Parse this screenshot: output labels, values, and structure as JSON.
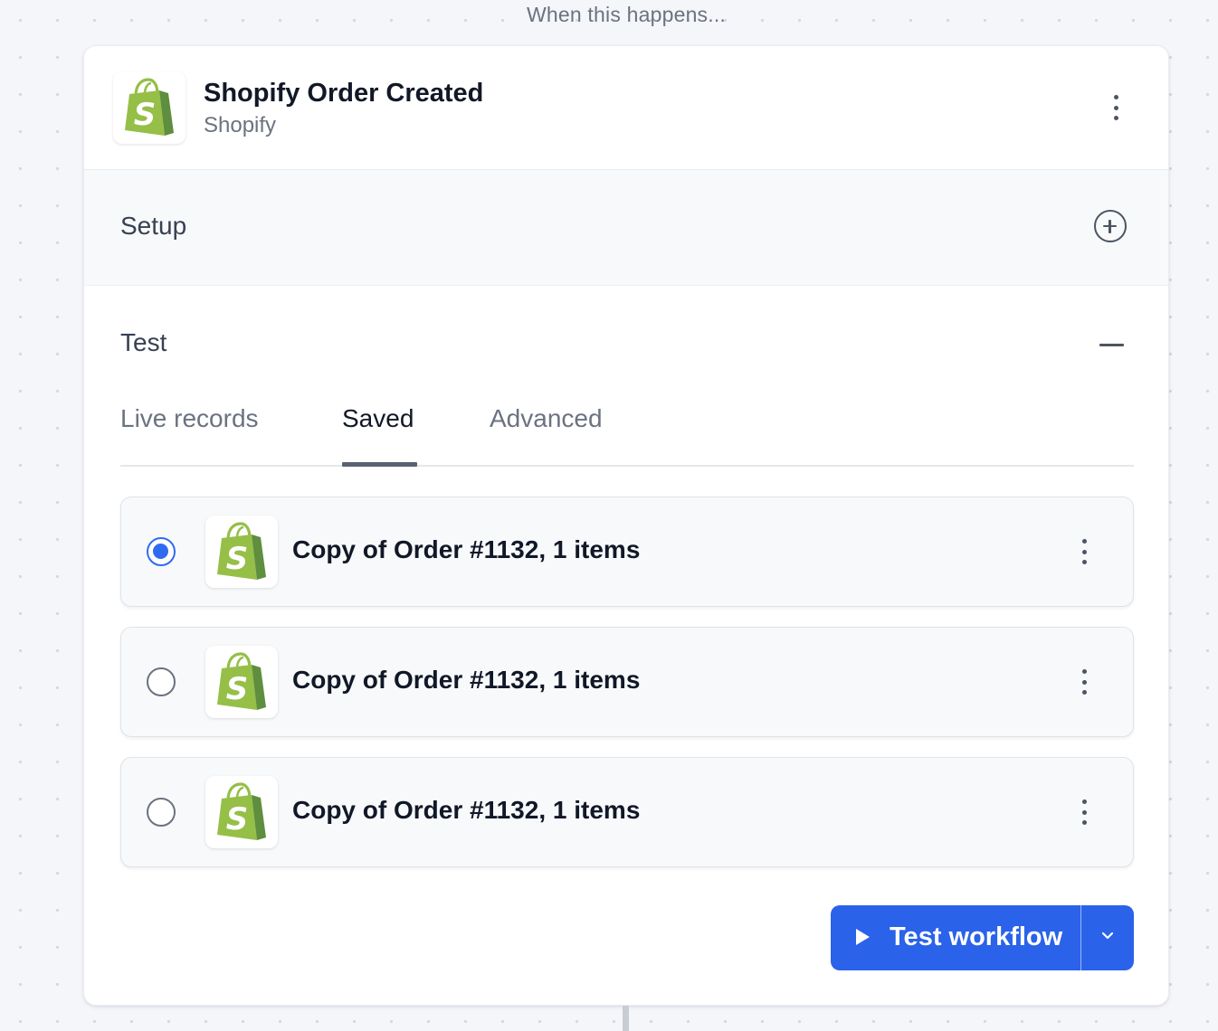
{
  "canvas": {
    "caption": "When this happens..."
  },
  "trigger": {
    "title": "Shopify Order Created",
    "app": "Shopify",
    "icon": "shopify-bag-icon"
  },
  "setup": {
    "title": "Setup",
    "expand_icon": "plus-circle-icon"
  },
  "test": {
    "title": "Test",
    "collapse_icon": "minus-icon",
    "tabs": [
      {
        "label": "Live records",
        "active": false
      },
      {
        "label": "Saved",
        "active": true
      },
      {
        "label": "Advanced",
        "active": false
      }
    ],
    "records": [
      {
        "label": "Copy of Order #1132, 1 items",
        "selected": true
      },
      {
        "label": "Copy of Order #1132, 1 items",
        "selected": false
      },
      {
        "label": "Copy of Order #1132, 1 items",
        "selected": false
      }
    ],
    "run_button": {
      "label": "Test workflow",
      "icon": "play-icon",
      "dropdown_icon": "chevron-down-icon"
    }
  },
  "colors": {
    "accent": "#2a62ea",
    "radio_selected": "#2f6bf0",
    "shopify_green": "#95bf47",
    "shopify_dark_green": "#5e8e3e"
  }
}
